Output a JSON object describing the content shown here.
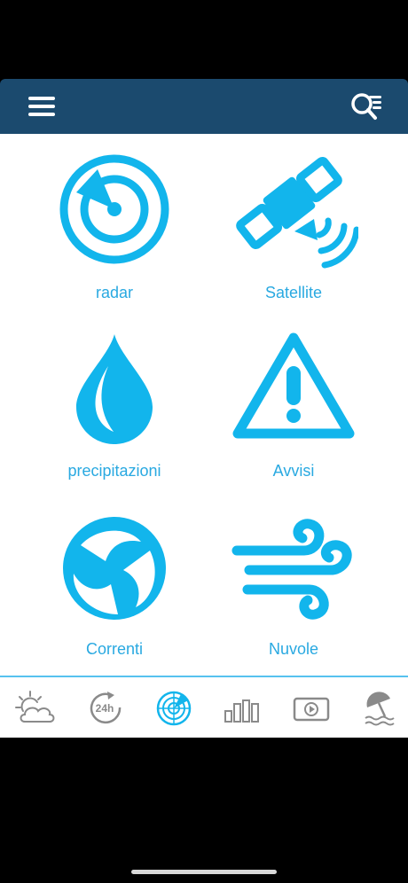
{
  "header": {
    "menu_icon": "hamburger-menu-icon",
    "search_icon": "search-list-icon",
    "background": "#1b4a6e"
  },
  "tiles": [
    {
      "label": "radar",
      "icon": "radar-icon"
    },
    {
      "label": "Satellite",
      "icon": "satellite-icon"
    },
    {
      "label": "precipitazioni",
      "icon": "water-drop-icon"
    },
    {
      "label": "Avvisi",
      "icon": "warning-triangle-icon"
    },
    {
      "label": "Correnti",
      "icon": "currents-swirl-icon"
    },
    {
      "label": "Nuvole",
      "icon": "wind-icon"
    }
  ],
  "tabbar": {
    "items": [
      {
        "icon": "partly-cloudy-icon",
        "active": false
      },
      {
        "icon": "24h-forecast-icon",
        "text": "24h",
        "active": false
      },
      {
        "icon": "radar-icon",
        "active": true
      },
      {
        "icon": "bar-chart-icon",
        "active": false
      },
      {
        "icon": "video-play-icon",
        "active": false
      },
      {
        "icon": "beach-umbrella-icon",
        "active": false
      }
    ]
  },
  "colors": {
    "accent": "#12b5ec",
    "label": "#29a9e1",
    "tab_inactive": "#8a8a8a",
    "header": "#1b4a6e"
  }
}
